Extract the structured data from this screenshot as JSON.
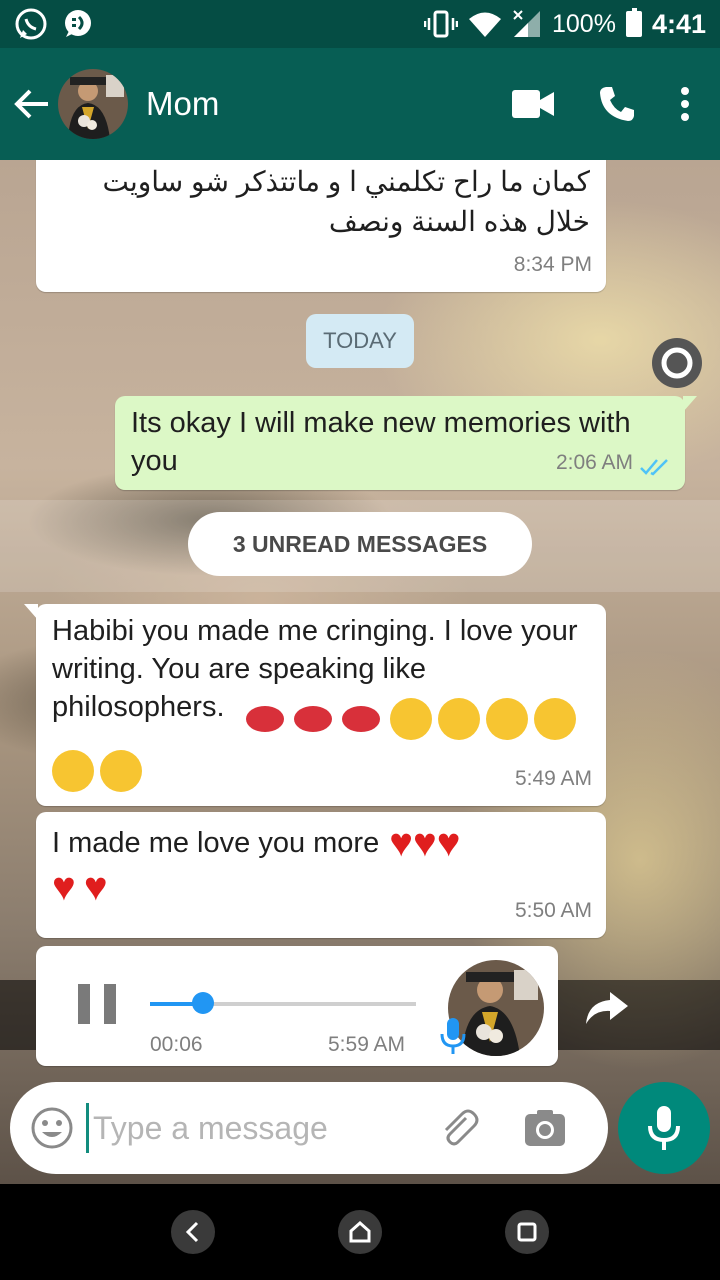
{
  "status_bar": {
    "battery": "100%",
    "time": "4:41"
  },
  "header": {
    "contact_name": "Mom"
  },
  "messages": {
    "m1": {
      "lines": [
        "كمان ما راح تكلمني ا و ماتتذكر شو ساويت",
        "خلال هذه السنة ونصف"
      ],
      "time": "8:34 PM"
    },
    "date_divider": "TODAY",
    "m2": {
      "text": "Its okay I will make new memories with you",
      "time": "2:06 AM"
    },
    "unread_divider": "3 UNREAD MESSAGES",
    "m3": {
      "text": "Habibi you made me cringing. I love your writing. You are speaking like philosophers.",
      "time": "5:49 AM"
    },
    "m4": {
      "text": "I made me love you more",
      "time": "5:50 AM"
    },
    "voice_note": {
      "elapsed": "00:06",
      "time": "5:59 AM",
      "progress": 0.2
    }
  },
  "composer": {
    "placeholder": "Type a message"
  },
  "colors": {
    "header": "#075e54",
    "status_bar": "#054d44",
    "outgoing_bubble": "#dcf8c6",
    "accent": "#00897b",
    "read_ticks": "#4fc3f7"
  }
}
